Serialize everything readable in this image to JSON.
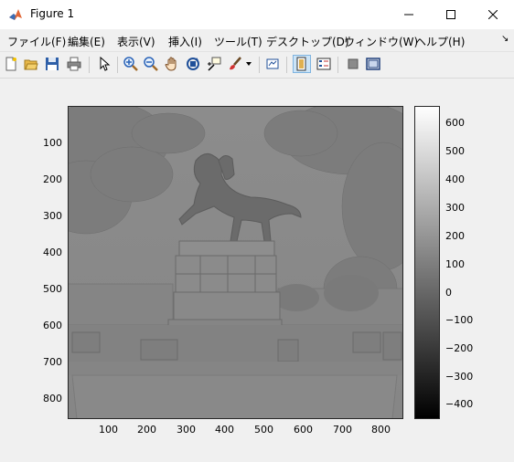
{
  "window": {
    "title": "Figure 1",
    "minimize_icon": "minimize-icon",
    "maximize_icon": "maximize-icon",
    "close_icon": "close-icon"
  },
  "menu": {
    "items": [
      {
        "label": "ファイル(F)"
      },
      {
        "label": "編集(E)"
      },
      {
        "label": "表示(V)"
      },
      {
        "label": "挿入(I)"
      },
      {
        "label": "ツール(T)"
      },
      {
        "label": "デスクトップ(D)"
      },
      {
        "label": "ウィンドウ(W)"
      },
      {
        "label": "ヘルプ(H)"
      }
    ],
    "dock_arrow": "↘"
  },
  "toolbar": {
    "buttons": [
      {
        "name": "new-figure-icon"
      },
      {
        "name": "open-file-icon"
      },
      {
        "name": "save-icon"
      },
      {
        "name": "print-icon"
      },
      {
        "name": "edit-plot-arrow-icon"
      },
      {
        "name": "zoom-in-icon"
      },
      {
        "name": "zoom-out-icon"
      },
      {
        "name": "pan-hand-icon"
      },
      {
        "name": "rotate-3d-icon"
      },
      {
        "name": "data-cursor-icon"
      },
      {
        "name": "brush-icon"
      },
      {
        "name": "link-plot-icon"
      },
      {
        "name": "insert-colorbar-icon",
        "active": true
      },
      {
        "name": "insert-legend-icon"
      },
      {
        "name": "hide-plot-tools-icon"
      },
      {
        "name": "show-plot-tools-icon"
      }
    ]
  },
  "axes": {
    "image_description_name": "grayscale-statue-image",
    "x_ticks": [
      "100",
      "200",
      "300",
      "400",
      "500",
      "600",
      "700",
      "800"
    ],
    "y_ticks": [
      "100",
      "200",
      "300",
      "400",
      "500",
      "600",
      "700",
      "800"
    ],
    "colorbar_ticks": [
      "600",
      "500",
      "400",
      "300",
      "200",
      "100",
      "0",
      "−100",
      "−200",
      "−300",
      "−400"
    ]
  },
  "colors": {
    "axes_bg": "#8a8a8a",
    "colorbar_top": "#ffffff",
    "colorbar_bottom": "#000000"
  }
}
